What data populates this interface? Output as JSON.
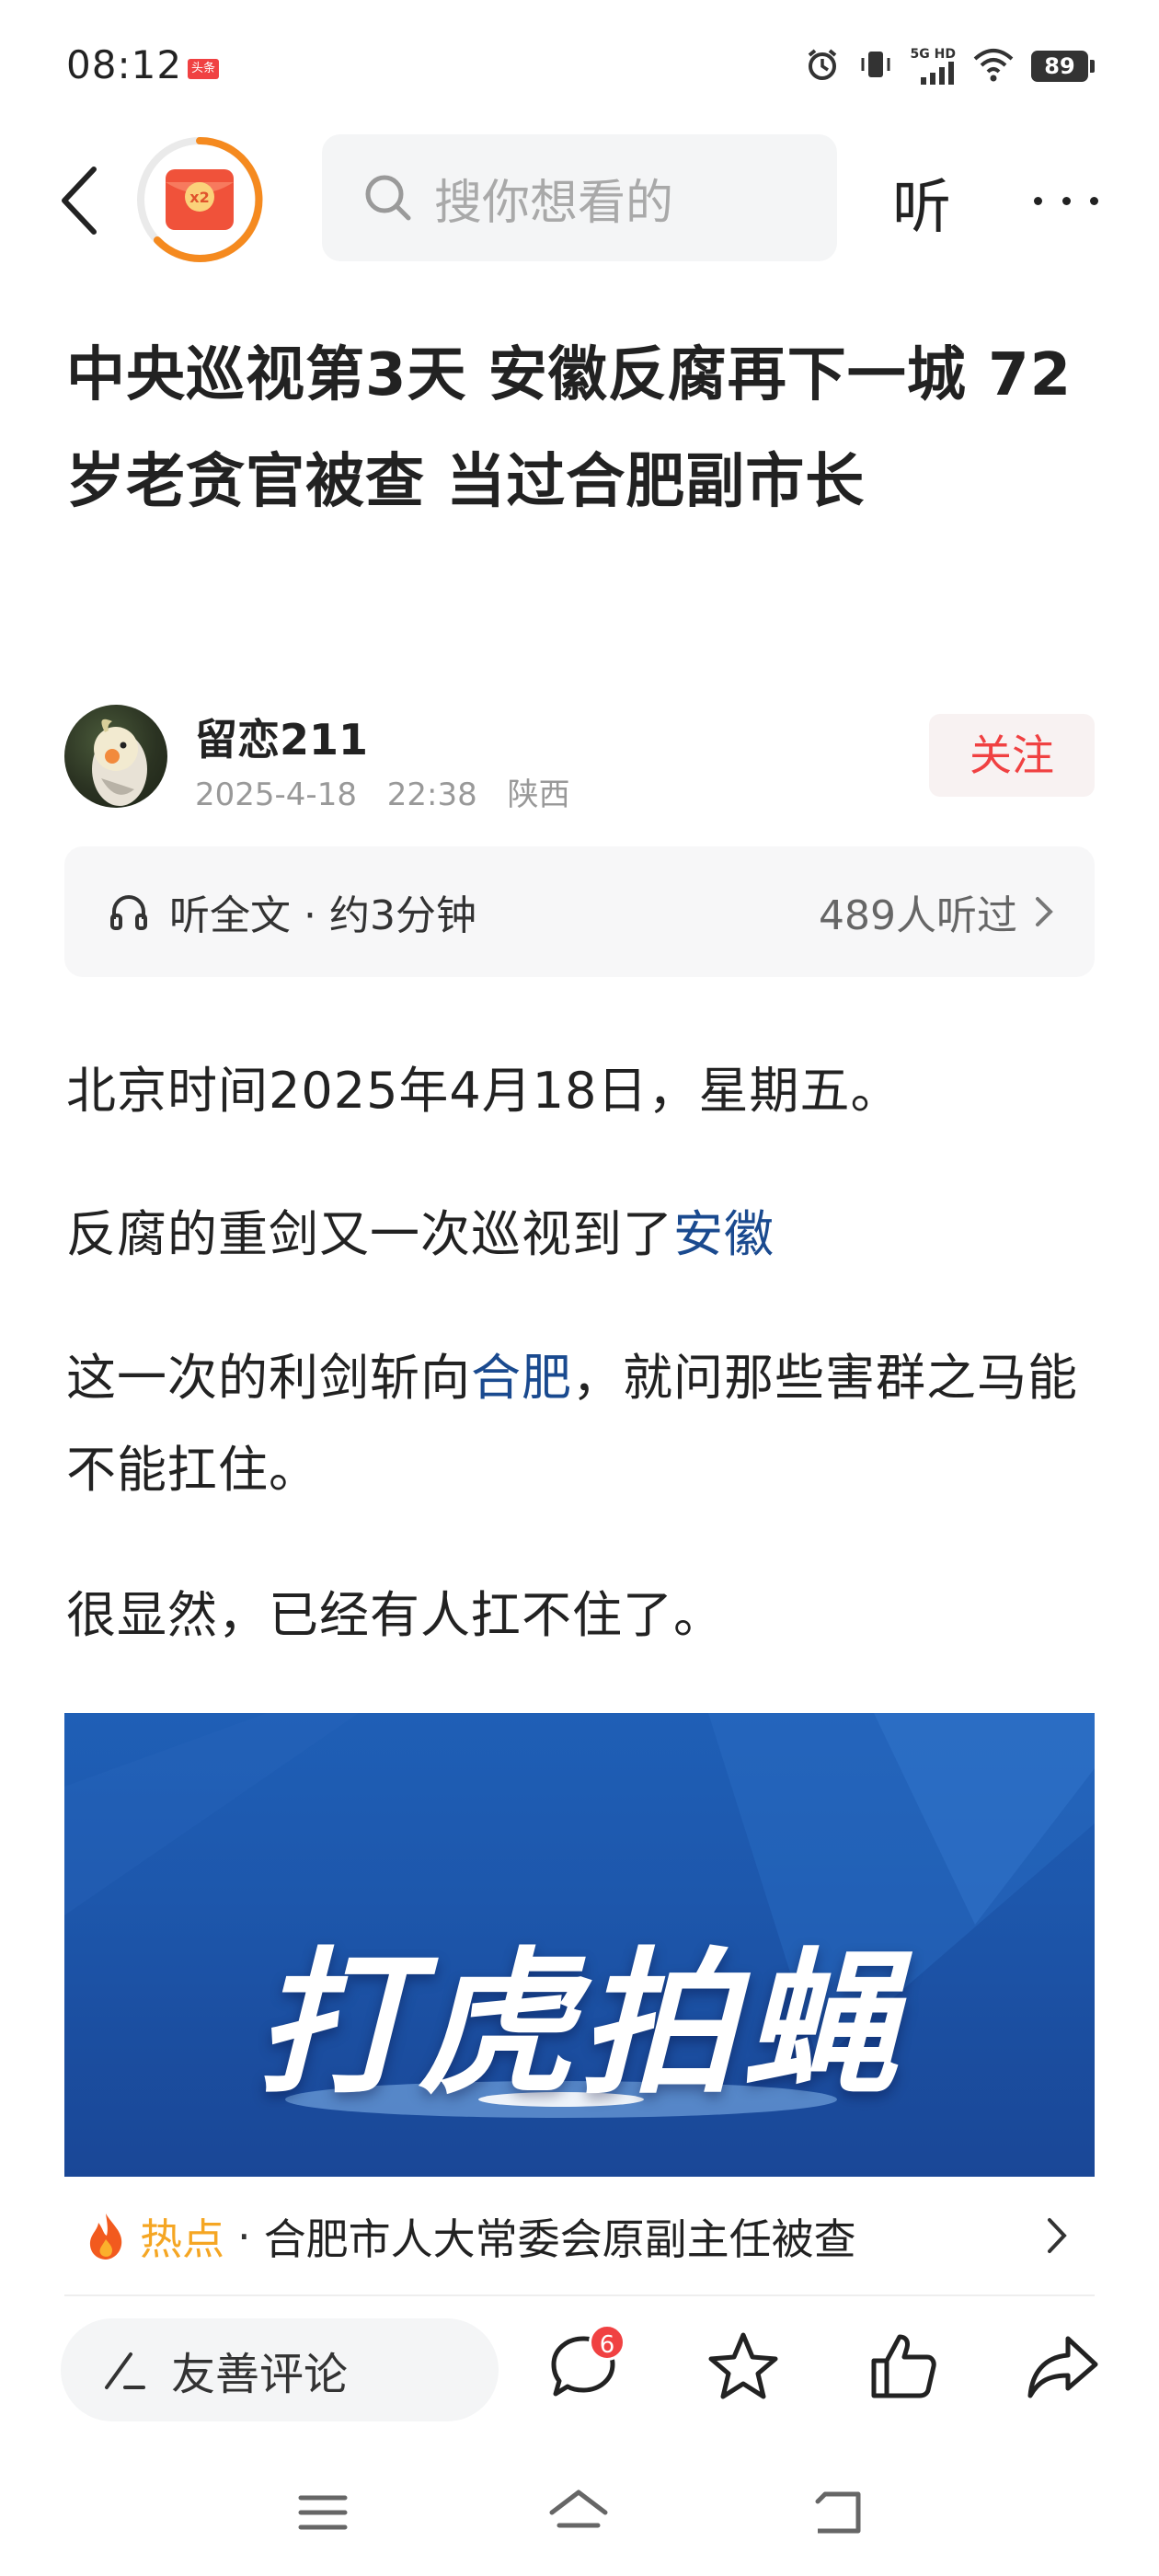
{
  "status_bar": {
    "time": "08:12",
    "app_badge": "头条",
    "network": "5G HD",
    "battery": "89"
  },
  "nav": {
    "search_placeholder": "搜你想看的",
    "listen_label": "听",
    "redpack_label": "x2"
  },
  "article": {
    "title": "中央巡视第3天 安徽反腐再下一城 72岁老贪官被查 当过合肥副市长",
    "author": {
      "name": "留恋211",
      "date": "2025-4-18",
      "time": "22:38",
      "location": "陕西",
      "follow_label": "关注"
    },
    "listen_bar": {
      "label": "听全文 · 约3分钟",
      "count": "489人听过"
    },
    "paragraphs": {
      "p1": "北京时间2025年4月18日，星期五。",
      "p2_text": "反腐的重剑又一次巡视到了",
      "p2_link": "安徽",
      "p3_text_a": "这一次的利剑斩向",
      "p3_link": "合肥",
      "p3_text_b": "，就问那些害群之马能不能扛住。",
      "p4": "很显然，已经有人扛不住了。"
    },
    "image_caption_text": "打虎拍蝇"
  },
  "hot_bar": {
    "label": "热点",
    "separator": "·",
    "text": "合肥市人大常委会原副主任被查"
  },
  "action_bar": {
    "comment_placeholder": "友善评论",
    "comment_count": "6"
  },
  "colors": {
    "accent_red": "#f04142",
    "link_blue": "#1a4a8f",
    "hot_orange": "#f5a623",
    "image_blue": "#1d57ac"
  }
}
